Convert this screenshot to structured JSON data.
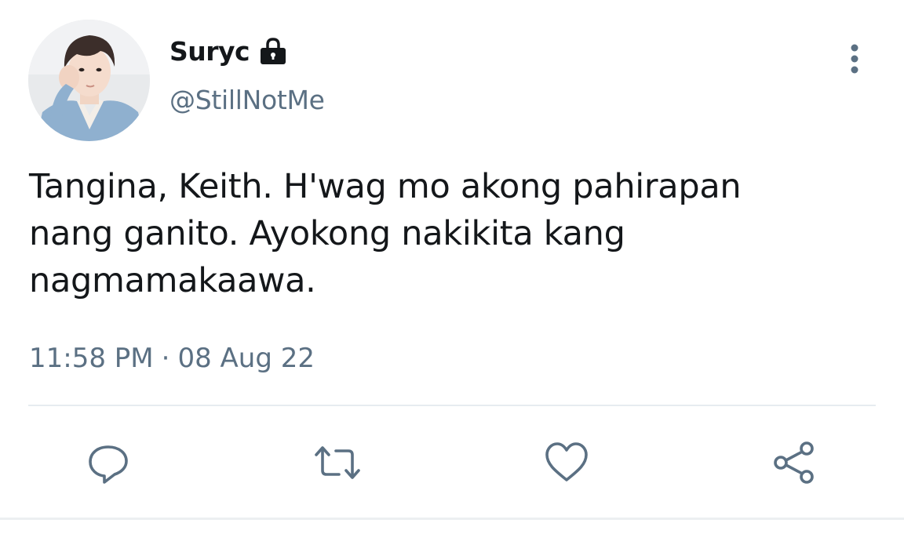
{
  "tweet": {
    "display_name": "Suryc",
    "handle": "@StillNotMe",
    "text": "Tangina, Keith. H'wag mo akong pahirapan\nnang ganito. Ayokong nakikita kang\nnagmamakaawa.",
    "time": "11:58 PM",
    "separator": "·",
    "date": "08 Aug 22"
  },
  "icons": {
    "lock": "lock-icon",
    "more": "more-vertical-icon",
    "reply": "reply-icon",
    "retweet": "retweet-icon",
    "like": "heart-icon",
    "share": "share-icon"
  },
  "colors": {
    "text_primary": "#14171a",
    "text_secondary": "#5b7083",
    "icon": "#5b7083",
    "divider": "#e6ecf0"
  }
}
